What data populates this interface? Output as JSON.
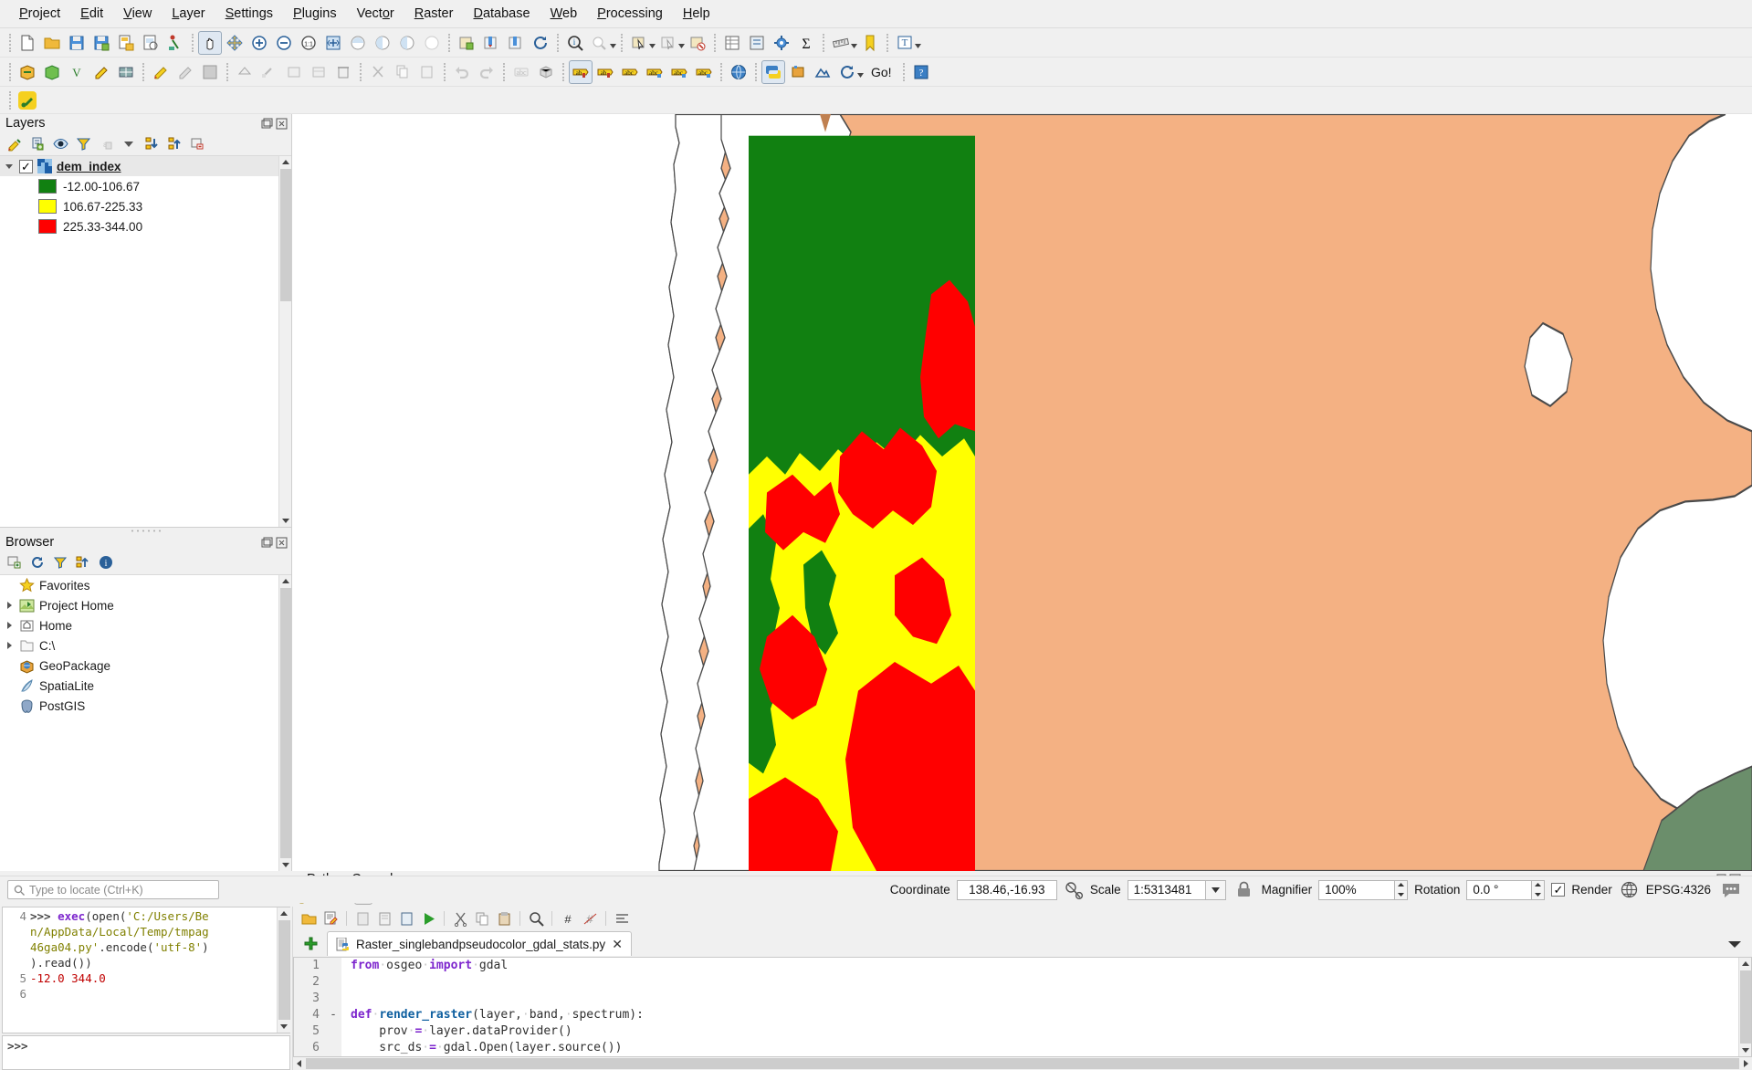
{
  "menubar": {
    "items": [
      {
        "label": "Project",
        "mnemonic": "P"
      },
      {
        "label": "Edit",
        "mnemonic": "E"
      },
      {
        "label": "View",
        "mnemonic": "V"
      },
      {
        "label": "Layer",
        "mnemonic": "L"
      },
      {
        "label": "Settings",
        "mnemonic": "S"
      },
      {
        "label": "Plugins",
        "mnemonic": "P"
      },
      {
        "label": "Vector",
        "mnemonic": "o"
      },
      {
        "label": "Raster",
        "mnemonic": "R"
      },
      {
        "label": "Database",
        "mnemonic": "D"
      },
      {
        "label": "Web",
        "mnemonic": "W"
      },
      {
        "label": "Processing",
        "mnemonic": "P"
      },
      {
        "label": "Help",
        "mnemonic": "H"
      }
    ]
  },
  "toolbar1": {
    "buttons": [
      "new-project-icon",
      "open-project-icon",
      "save-project-icon",
      "save-project-as-icon",
      "new-print-layout-icon",
      "show-layout-manager-icon",
      "style-manager-icon",
      "pan-map-icon",
      "pan-to-selection-icon",
      "zoom-in-icon",
      "zoom-out-icon",
      "zoom-native-icon",
      "zoom-full-icon",
      "zoom-to-selection-icon",
      "zoom-to-layer-icon",
      "zoom-last-icon",
      "zoom-next-icon",
      "refresh-icon-a",
      "refresh-icon-b",
      "refresh-icon-c",
      "refresh-map-icon",
      "identify-features-icon",
      "measure-line-icon",
      "select-features-icon",
      "deselect-icon",
      "open-attribute-table-icon",
      "open-field-calculator-icon",
      "processing-toolbox-icon",
      "statistical-summary-icon",
      "map-tips-icon",
      "show-bookmarks-icon",
      "text-annotation-icon"
    ]
  },
  "toolbar2": {
    "buttons": [
      "new-shapefile-layer-icon",
      "new-spatialite-layer-icon",
      "new-gpx-layer-icon",
      "new-memory-layer-icon",
      "new-mesh-layer-icon",
      "toggle-editing-icon",
      "edit-pencil-icon",
      "save-layer-edits-icon",
      "add-feature-icon",
      "vertex-tool-icon",
      "move-feature-icon",
      "modify-attributes-icon",
      "delete-selected-icon",
      "cut-features-icon",
      "copy-features-icon",
      "paste-features-icon",
      "undo-icon",
      "redo-icon",
      "undo-stack-icon",
      "rotate-label-icon",
      "3d-map-view-icon",
      "label-pin-icon",
      "label-show-hide-icon",
      "label-highlight-icon",
      "label-move-icon",
      "label-rotate-icon",
      "label-change-icon",
      "metasearch-icon",
      "python-console-icon",
      "plugin-manager-icon",
      "geometry-checker-icon",
      "refresh-plugins-icon"
    ],
    "go_label": "Go!",
    "help_label": "?"
  },
  "toolbar3": {
    "buttons": [
      "plugin-toolbar-icon"
    ]
  },
  "layers_panel": {
    "title": "Layers",
    "toolbar_buttons": [
      "open-layer-styling-icon",
      "add-group-icon",
      "manage-map-themes-icon",
      "filter-legend-icon",
      "expression-filter-icon",
      "filter-dropdown-icon",
      "expand-all-icon",
      "collapse-all-icon",
      "remove-layer-icon"
    ],
    "layer": {
      "name": "dem_index",
      "checked": true,
      "icon": "raster-layer-icon",
      "classes": [
        {
          "color": "#118011",
          "label": "-12.00-106.67"
        },
        {
          "color": "#ffff00",
          "label": "106.67-225.33"
        },
        {
          "color": "#ff0000",
          "label": "225.33-344.00"
        }
      ]
    }
  },
  "browser_panel": {
    "title": "Browser",
    "toolbar_buttons": [
      "add-selected-layers-icon",
      "refresh-icon",
      "filter-browser-icon",
      "collapse-all-icon",
      "properties-icon"
    ],
    "items": [
      {
        "label": "Favorites",
        "icon": "star-icon",
        "expandable": false
      },
      {
        "label": "Project Home",
        "icon": "project-home-icon",
        "expandable": true
      },
      {
        "label": "Home",
        "icon": "home-icon",
        "expandable": true
      },
      {
        "label": "C:\\",
        "icon": "folder-icon",
        "expandable": true
      },
      {
        "label": "GeoPackage",
        "icon": "geopackage-icon",
        "expandable": false
      },
      {
        "label": "SpatiaLite",
        "icon": "spatialite-icon",
        "expandable": false
      },
      {
        "label": "PostGIS",
        "icon": "postgis-icon",
        "expandable": false
      }
    ]
  },
  "python_console": {
    "title": "Python Console",
    "toolbar_buttons": [
      "clear-console-icon",
      "run-script-icon",
      "show-editor-icon",
      "options-icon",
      "help-icon"
    ],
    "output_lines": [
      {
        "num": "4",
        "segments": [
          {
            "t": ">>> ",
            "c": "prompt"
          },
          {
            "t": "exec",
            "c": "kw"
          },
          {
            "t": "(open(",
            "c": "pln"
          },
          {
            "t": "'C:/Users/Be",
            "c": "str"
          }
        ]
      },
      {
        "num": "",
        "segments": [
          {
            "t": "n/AppData/Local/Temp/tmpag",
            "c": "str"
          }
        ]
      },
      {
        "num": "",
        "segments": [
          {
            "t": "46ga04.py'",
            "c": "str"
          },
          {
            "t": ".encode(",
            "c": "pln"
          },
          {
            "t": "'utf-8'",
            "c": "str"
          },
          {
            "t": ")",
            "c": "pln"
          }
        ]
      },
      {
        "num": "",
        "segments": [
          {
            "t": ").read())",
            "c": "pln"
          }
        ]
      },
      {
        "num": "5",
        "segments": [
          {
            "t": "-12.0 344.0",
            "c": "num"
          }
        ]
      },
      {
        "num": "6",
        "segments": []
      }
    ],
    "input_prompt": ">>>"
  },
  "editor": {
    "toolbar_buttons": [
      "open-script-icon",
      "save-script-icon",
      "cut-icon",
      "copy-icon",
      "paste-icon",
      "run-script-icon",
      "cut2-icon",
      "copy2-icon",
      "paste2-icon",
      "find-icon",
      "comment-icon",
      "uncomment-icon",
      "reformat-icon"
    ],
    "new_tab_icon": "new-tab-icon",
    "tab": {
      "title": "Raster_singlebandpseudocolor_gdal_stats.py",
      "icon": "python-file-icon",
      "close": "✕"
    },
    "lines": [
      {
        "num": "1",
        "fold": "",
        "segments": [
          {
            "t": "from",
            "c": "kw"
          },
          {
            "t": "·",
            "c": "dot"
          },
          {
            "t": "osgeo",
            "c": "pln"
          },
          {
            "t": "·",
            "c": "dot"
          },
          {
            "t": "import",
            "c": "kw"
          },
          {
            "t": "·",
            "c": "dot"
          },
          {
            "t": "gdal",
            "c": "pln"
          }
        ]
      },
      {
        "num": "2",
        "fold": "",
        "segments": []
      },
      {
        "num": "3",
        "fold": "",
        "segments": []
      },
      {
        "num": "4",
        "fold": "-",
        "segments": [
          {
            "t": "def",
            "c": "kw"
          },
          {
            "t": "·",
            "c": "dot"
          },
          {
            "t": "render_raster",
            "c": "fn"
          },
          {
            "t": "(layer,",
            "c": "pln"
          },
          {
            "t": "·",
            "c": "dot"
          },
          {
            "t": "band,",
            "c": "pln"
          },
          {
            "t": "·",
            "c": "dot"
          },
          {
            "t": "spectrum",
            "c": "pln"
          },
          {
            "t": "):",
            "c": "pln"
          }
        ]
      },
      {
        "num": "5",
        "fold": "",
        "segments": [
          {
            "t": "    prov",
            "c": "pln"
          },
          {
            "t": "·",
            "c": "dot"
          },
          {
            "t": "=",
            "c": "kw"
          },
          {
            "t": "·",
            "c": "dot"
          },
          {
            "t": "layer.dataProvider()",
            "c": "pln"
          }
        ]
      },
      {
        "num": "6",
        "fold": "",
        "segments": [
          {
            "t": "    src_ds",
            "c": "pln"
          },
          {
            "t": "·",
            "c": "dot"
          },
          {
            "t": "=",
            "c": "kw"
          },
          {
            "t": "·",
            "c": "dot"
          },
          {
            "t": "gdal.Open(layer.source())",
            "c": "pln"
          }
        ]
      }
    ]
  },
  "statusbar": {
    "locate_placeholder": "Type to locate (Ctrl+K)",
    "coordinate_label": "Coordinate",
    "coordinate_value": "138.46,-16.93",
    "scale_label": "Scale",
    "scale_value": "1:5313481",
    "magnifier_label": "Magnifier",
    "magnifier_value": "100%",
    "rotation_label": "Rotation",
    "rotation_value": "0.0 °",
    "render_label": "Render",
    "render_checked": true,
    "crs_label": "EPSG:4326",
    "messages_icon": "messages-icon",
    "lock_icon": "lock-icon",
    "globe_icon": "globe-icon"
  },
  "map": {
    "background": "#ffffff",
    "land_color": "#f4b183",
    "sea_color": "#ffffff",
    "green_color": "#118011",
    "yellow_color": "#ffff00",
    "red_color": "#ff0000",
    "dark_green_color": "#6b8e6b"
  }
}
